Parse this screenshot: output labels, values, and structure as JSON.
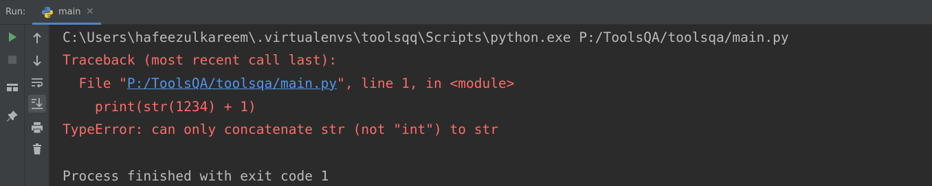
{
  "run_panel": {
    "label": "Run:",
    "tab": {
      "title": "main",
      "close_glyph": "✕",
      "icon": "python-icon"
    }
  },
  "left_toolbar": [
    {
      "name": "rerun-button",
      "icon": "play-icon"
    },
    {
      "name": "stop-button",
      "icon": "stop-icon"
    },
    {
      "name": "layout-button",
      "icon": "layout-icon"
    },
    {
      "name": "pin-button",
      "icon": "pin-icon"
    }
  ],
  "console_toolbar": [
    {
      "name": "up-button",
      "icon": "arrow-up-icon"
    },
    {
      "name": "down-button",
      "icon": "arrow-down-icon"
    },
    {
      "name": "soft-wrap-button",
      "icon": "soft-wrap-icon"
    },
    {
      "name": "scroll-to-end-button",
      "icon": "scroll-to-end-icon"
    },
    {
      "name": "print-button",
      "icon": "print-icon"
    },
    {
      "name": "clear-all-button",
      "icon": "trash-icon"
    }
  ],
  "console": {
    "command": "C:\\Users\\hafeezulkareem\\.virtualenvs\\toolsqq\\Scripts\\python.exe P:/ToolsQA/toolsqa/main.py",
    "traceback_header": "Traceback (most recent call last):",
    "file_prefix": "  File \"",
    "file_link": "P:/ToolsQA/toolsqa/main.py",
    "file_suffix": "\", line 1, in <module>",
    "code_line": "    print(str(1234) + 1)",
    "error": "TypeError: can only concatenate str (not \"int\") to str",
    "exit_message": "Process finished with exit code 1"
  },
  "colors": {
    "background": "#2b2b2b",
    "toolbar": "#3c3f41",
    "normal_text": "#bbbbbb",
    "error_text": "#ff6b68",
    "link": "#5394ec",
    "run_green": "#59a869"
  }
}
